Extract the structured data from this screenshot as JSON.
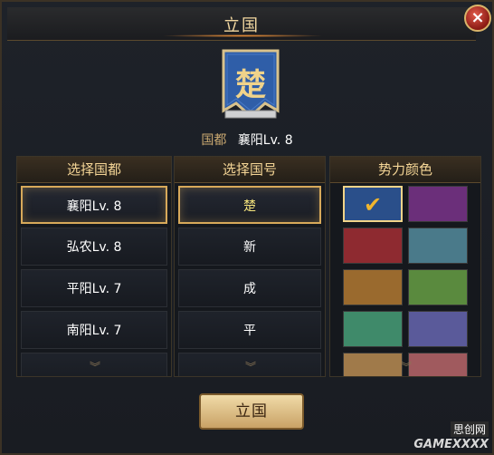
{
  "dialog": {
    "title": "立国",
    "close_label": "×"
  },
  "banner": {
    "char": "楚",
    "color": "#2f5ea8"
  },
  "capital": {
    "label": "国都",
    "value": "襄阳Lv. 8"
  },
  "panels": {
    "capital_list": {
      "header": "选择国都",
      "items": [
        "襄阳Lv. 8",
        "弘农Lv. 8",
        "平阳Lv. 7",
        "南阳Lv. 7"
      ],
      "selected_index": 0
    },
    "name_list": {
      "header": "选择国号",
      "items": [
        "楚",
        "新",
        "成",
        "平"
      ],
      "selected_index": 0
    },
    "colors": {
      "header": "势力颜色",
      "swatches": [
        "#2a4f8a",
        "#6b2f7a",
        "#8e2a30",
        "#4a7a8a",
        "#9a6a2e",
        "#5a8a3e",
        "#3f8a6a",
        "#5a5a9a",
        "#a07a4a",
        "#a05a5e"
      ],
      "selected_index": 0
    }
  },
  "scroll_indicator": "︾",
  "confirm_button": "立国",
  "watermark": {
    "top": "思创网",
    "bottom": "GAMEXXXX"
  }
}
